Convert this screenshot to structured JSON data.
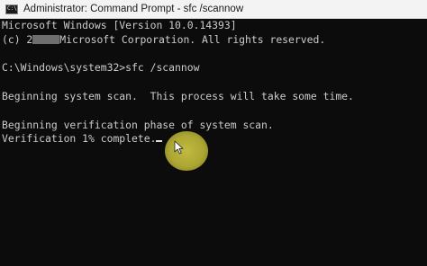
{
  "window": {
    "title": "Administrator: Command Prompt - sfc  /scannow"
  },
  "console": {
    "line1": "Microsoft Windows [Version 10.0.14393]",
    "line2_prefix": "(c) 2",
    "line2_suffix": "Microsoft Corporation. All rights reserved.",
    "line3": "",
    "line4": "C:\\Windows\\system32>sfc /scannow",
    "line5": "",
    "line6": "Beginning system scan.  This process will take some time.",
    "line7": "",
    "line8": "Beginning verification phase of system scan.",
    "line9": "Verification 1% complete."
  },
  "colors": {
    "console_background": "#0c0c0c",
    "console_text": "#cccccc",
    "titlebar_background": "#f3f3f3",
    "pointer_highlight": "#d6cf40"
  },
  "icons": {
    "app": "command-prompt-icon",
    "cursor": "mouse-pointer-icon"
  }
}
